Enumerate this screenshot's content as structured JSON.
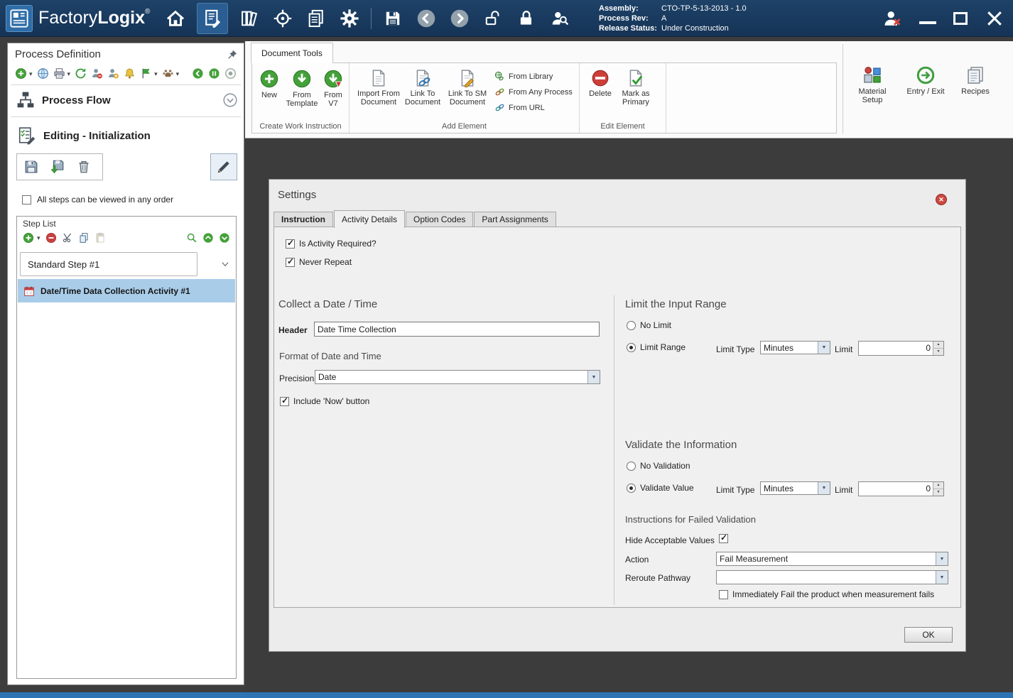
{
  "icons": {
    "caret_down": "▾",
    "dropdown_arrow": "▼",
    "spinner_up": "▲",
    "spinner_down": "▼",
    "check": "✓",
    "close_x": "✕"
  },
  "colors": {
    "titlebar": "#17395E",
    "frame_blue": "#2E74B5",
    "workspace": "#3C3C3C",
    "selection": "#A9CDE9",
    "green": "#3FA03A",
    "red": "#C94040"
  },
  "titlebar": {
    "app_name_light": "Factory",
    "app_name_bold": "Logix",
    "registered": "®",
    "info": {
      "assembly_label": "Assembly:",
      "assembly_value": "CTO-TP-5-13-2013 - 1.0",
      "process_rev_label": "Process Rev:",
      "process_rev_value": "A",
      "release_status_label": "Release Status:",
      "release_status_value": "Under Construction"
    }
  },
  "sidebar": {
    "title": "Process Definition",
    "process_flow_label": "Process Flow",
    "editing_label": "Editing - Initialization",
    "order_checkbox_label": "All steps can be viewed in any order",
    "step_list": {
      "title": "Step List",
      "selected_step": "Standard Step #1",
      "activity": "Date/Time Data Collection Activity #1"
    }
  },
  "ribbon": {
    "tab_label": "Document Tools",
    "create_group": {
      "label": "Create Work Instruction",
      "new": "New",
      "from_template": "From Template",
      "from_v7": "From V7"
    },
    "add_group": {
      "label": "Add Element",
      "import_from_document": "Import From Document",
      "link_to_document": "Link To Document",
      "link_to_sm_document": "Link To SM Document",
      "from_library": "From Library",
      "from_any_process": "From Any Process",
      "from_url": "From URL"
    },
    "edit_group": {
      "label": "Edit Element",
      "delete": "Delete",
      "mark_as_primary": "Mark as Primary"
    },
    "right_tools": {
      "material_setup": "Material Setup",
      "entry_exit": "Entry / Exit",
      "recipes": "Recipes"
    }
  },
  "dialog": {
    "title": "Settings",
    "tabs": [
      "Instruction",
      "Activity Details",
      "Option Codes",
      "Part Assignments"
    ],
    "required_checkbox": "Is Activity Required?",
    "never_repeat_checkbox": "Never Repeat",
    "collect_section": {
      "heading": "Collect a Date / Time",
      "header_label": "Header",
      "header_value": "Date Time Collection",
      "format_heading": "Format of Date and Time",
      "precision_label": "Precision",
      "precision_value": "Date",
      "include_now_label": "Include 'Now' button"
    },
    "limit_section": {
      "heading": "Limit the Input Range",
      "no_limit": "No Limit",
      "limit_range": "Limit Range",
      "limit_type_label": "Limit Type",
      "limit_type_value": "Minutes",
      "limit_label": "Limit",
      "limit_value": "0"
    },
    "validate_section": {
      "heading": "Validate the Information",
      "no_validation": "No Validation",
      "validate_value": "Validate Value",
      "limit_type_label": "Limit Type",
      "limit_type_value": "Minutes",
      "limit_label": "Limit",
      "limit_value": "0"
    },
    "failed_section": {
      "heading": "Instructions for Failed Validation",
      "hide_values_label": "Hide Acceptable Values",
      "action_label": "Action",
      "action_value": "Fail Measurement",
      "reroute_label": "Reroute Pathway",
      "reroute_value": "",
      "fail_checkbox_label": "Immediately Fail the product when measurement fails"
    },
    "ok_button": "OK"
  }
}
